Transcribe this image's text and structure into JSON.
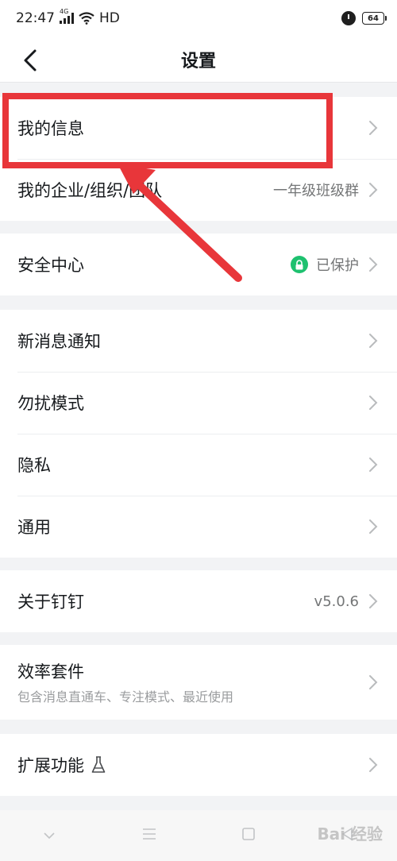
{
  "status_bar": {
    "time": "22:47",
    "network_type": "4G",
    "hd_label": "HD",
    "battery": "64"
  },
  "nav": {
    "title": "设置"
  },
  "groups": {
    "account": {
      "my_info": "我的信息",
      "my_org": "我的企业/组织/团队",
      "my_org_value": "一年级班级群"
    },
    "security": {
      "label": "安全中心",
      "status": "已保护"
    },
    "prefs": {
      "notifications": "新消息通知",
      "dnd": "勿扰模式",
      "privacy": "隐私",
      "general": "通用"
    },
    "about": {
      "label": "关于钉钉",
      "version": "v5.0.6"
    },
    "efficiency": {
      "label": "效率套件",
      "subtitle": "包含消息直通车、专注模式、最近使用"
    },
    "extensions": {
      "label": "扩展功能"
    }
  },
  "watermark": "Bai 经验",
  "colors": {
    "accent_green": "#1ec16f",
    "annotation_red": "#e8363a"
  },
  "icons": {
    "back": "chevron-left-icon",
    "chevron": "chevron-right-icon",
    "shield": "lock-icon",
    "flask": "flask-icon"
  }
}
